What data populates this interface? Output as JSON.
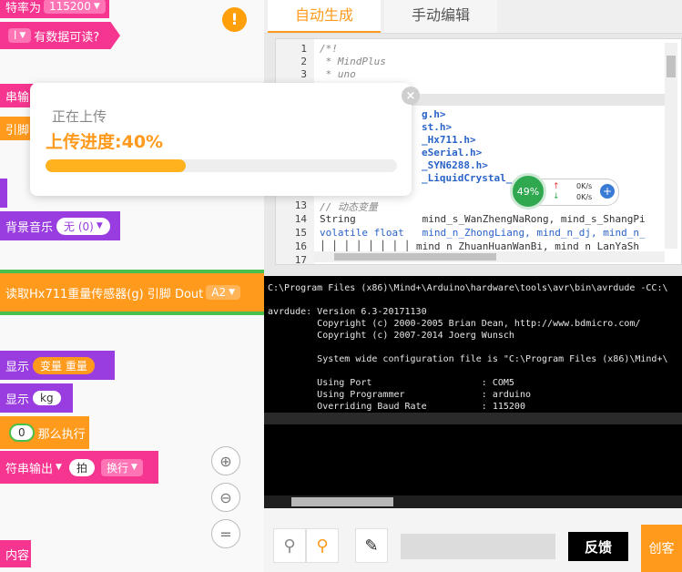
{
  "blocks": {
    "baud_label": "特率为",
    "baud_value": "115200",
    "has_data_prefix": "",
    "has_data": "有数据可读?",
    "serial_output_label": "串输出",
    "pin_label": "引脚",
    "bg_music_label": "背景音乐",
    "bg_music_value": "无 (0)",
    "hx711_label": "读取Hx711重量传感器(g) 引脚 Dout",
    "hx711_pin": "A2",
    "show_label_1": "显示",
    "show_var": "变量 重量",
    "show_label_2": "显示",
    "show_unit": "kg",
    "zero_value": "0",
    "then_label": "那么执行",
    "serial_out_label": "符串输出",
    "beat_label": "拍",
    "newline_label": "换行",
    "content_label": "内容"
  },
  "tabs": [
    {
      "label": "自动生成",
      "active": true
    },
    {
      "label": "手动编辑",
      "active": false
    }
  ],
  "editor": {
    "line_numbers": [
      "1",
      "2",
      "3",
      "",
      "",
      "",
      "",
      "",
      "",
      "",
      "",
      "",
      "13",
      "14",
      "15",
      "16",
      "17"
    ],
    "lines": [
      "/*!",
      " * MindPlus",
      " * uno",
      "g.h>",
      "st.h>",
      "_Hx711.h>",
      "eSerial.h>",
      "_SYN6288.h>",
      "_LiquidCrystal_",
      "// 动态变量",
      "String           mind_s_WanZhengNaRong, mind_s_ShangPi",
      "volatile float   mind_n_ZhongLiang, mind_n_dj, mind_n_",
      "│ │ │ │ │ │ │ │ mind_n_ZhuanHuanWanBi, mind_n_LanYaSh"
    ],
    "keyword_string": "String",
    "keyword_volatile": "volatile float"
  },
  "upload": {
    "status": "正在上传",
    "progress_text": "上传进度:40%",
    "progress": 40,
    "close": "×"
  },
  "net": {
    "percent": "49%",
    "up": "0K/s",
    "down": "0K/s"
  },
  "terminal": {
    "lines": [
      "C:\\Program Files (x86)\\Mind+\\Arduino\\hardware\\tools\\avr\\bin\\avrdude -CC:\\",
      "",
      "avrdude: Version 6.3-20171130",
      "         Copyright (c) 2000-2005 Brian Dean, http://www.bdmicro.com/",
      "         Copyright (c) 2007-2014 Joerg Wunsch",
      "",
      "         System wide configuration file is \"C:\\Program Files (x86)\\Mind+\\",
      "",
      "         Using Port                    : COM5",
      "         Using Programmer              : arduino",
      "         Overriding Baud Rate          : 115200"
    ]
  },
  "bottom": {
    "badge": "反馈",
    "badge2": "创客"
  },
  "colors": {
    "orange": "#ff9a1c",
    "pink": "#f5358f",
    "purple": "#9a3de0",
    "green": "#2fa84f"
  }
}
